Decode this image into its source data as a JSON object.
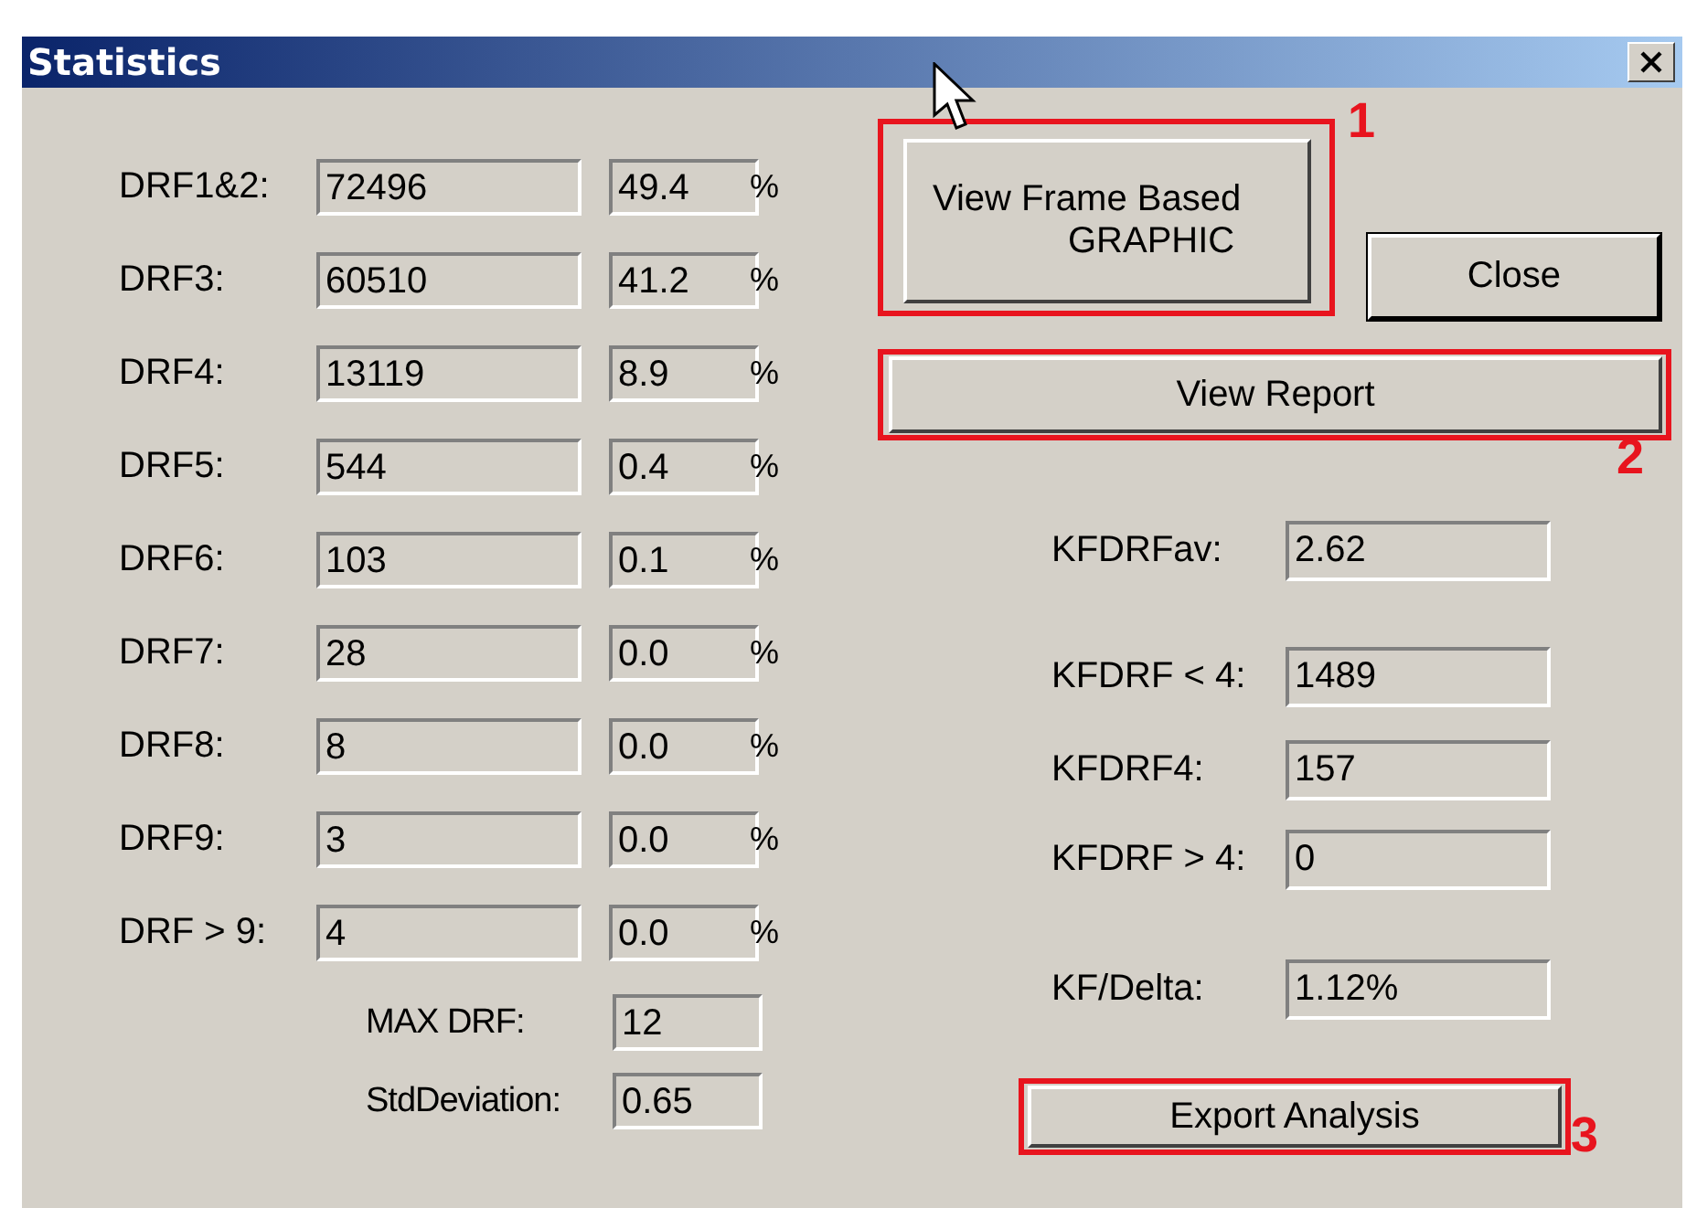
{
  "window": {
    "title": "Statistics"
  },
  "drf_rows": [
    {
      "label": "DRF1&2:",
      "count": "72496",
      "percent": "49.4",
      "unit": "%"
    },
    {
      "label": "DRF3:",
      "count": "60510",
      "percent": "41.2",
      "unit": "%"
    },
    {
      "label": "DRF4:",
      "count": "13119",
      "percent": "8.9",
      "unit": "%"
    },
    {
      "label": "DRF5:",
      "count": "544",
      "percent": "0.4",
      "unit": "%"
    },
    {
      "label": "DRF6:",
      "count": "103",
      "percent": "0.1",
      "unit": "%"
    },
    {
      "label": "DRF7:",
      "count": "28",
      "percent": "0.0",
      "unit": "%"
    },
    {
      "label": "DRF8:",
      "count": "8",
      "percent": "0.0",
      "unit": "%"
    },
    {
      "label": "DRF9:",
      "count": "3",
      "percent": "0.0",
      "unit": "%"
    },
    {
      "label": "DRF > 9:",
      "count": "4",
      "percent": "0.0",
      "unit": "%"
    }
  ],
  "summary": [
    {
      "label": "MAX DRF:",
      "value": "12"
    },
    {
      "label": "StdDeviation:",
      "value": "0.65"
    }
  ],
  "buttons": [
    {
      "kind": "graphic",
      "lines": [
        "View Frame Based",
        "GRAPHIC"
      ],
      "annotation": "1"
    },
    {
      "kind": "close",
      "label": "Close"
    },
    {
      "kind": "report",
      "label": "View Report",
      "annotation": "2"
    },
    {
      "kind": "export",
      "label": "Export Analysis",
      "annotation": "3"
    }
  ],
  "kf_fields": [
    {
      "label": "KFDRFav:",
      "value": "2.62"
    },
    {
      "label": "KFDRF < 4:",
      "value": "1489"
    },
    {
      "label": "KFDRF4:",
      "value": "157"
    },
    {
      "label": "KFDRF > 4:",
      "value": "0"
    },
    {
      "label": "KF/Delta:",
      "value": "1.12%"
    }
  ]
}
